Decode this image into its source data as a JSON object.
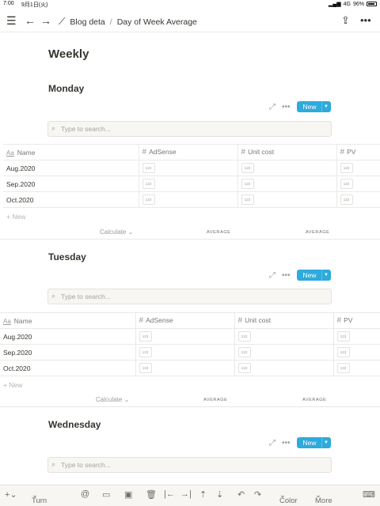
{
  "status": {
    "time": "7:00",
    "date": "9月1日(火)",
    "network": "4G",
    "battery": "96%"
  },
  "nav": {
    "breadcrumb_parent": "Blog deta",
    "breadcrumb_sep": "/",
    "breadcrumb_current": "Day of Week Average"
  },
  "page": {
    "title": "Weekly"
  },
  "common": {
    "new_label": "New",
    "search_placeholder": "Type to search...",
    "new_row_label": "New",
    "calculate_label": "Calculate",
    "average_label": "AVERAGE",
    "columns": [
      "Name",
      "AdSense",
      "Unit cost",
      "PV"
    ],
    "cell_placeholder": "123"
  },
  "sections": [
    {
      "title": "Monday",
      "rows": [
        "Aug.2020",
        "Sep.2020",
        "Oct.2020"
      ]
    },
    {
      "title": "Tuesday",
      "rows": [
        "Aug.2020",
        "Sep.2020",
        "Oct.2020"
      ]
    },
    {
      "title": "Wednesday",
      "rows": []
    }
  ],
  "bottombar": {
    "turn_into": "Turn into",
    "color": "Color",
    "more": "More"
  }
}
